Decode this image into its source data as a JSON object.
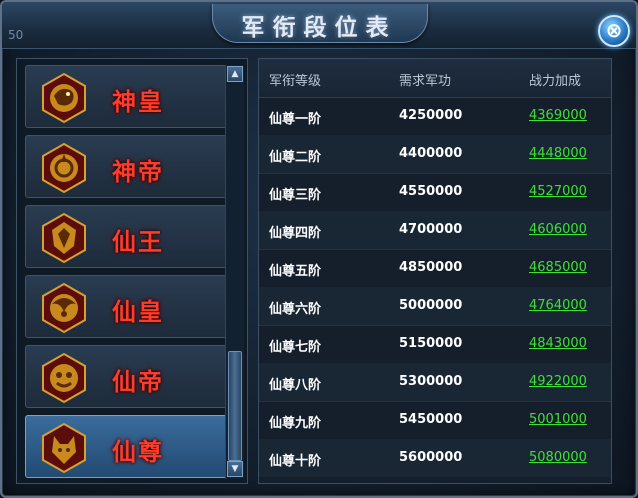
{
  "window": {
    "title": "军衔段位表",
    "corner_number": "50"
  },
  "ranks": [
    {
      "name": "神皇",
      "emblem": "dragon-emblem-icon"
    },
    {
      "name": "神帝",
      "emblem": "flame-emblem-icon"
    },
    {
      "name": "仙王",
      "emblem": "armor-emblem-icon"
    },
    {
      "name": "仙皇",
      "emblem": "phoenix-emblem-icon"
    },
    {
      "name": "仙帝",
      "emblem": "beast-emblem-icon"
    },
    {
      "name": "仙尊",
      "emblem": "wolf-emblem-icon"
    }
  ],
  "selected_rank": "仙尊",
  "table": {
    "headers": [
      "军衔等级",
      "需求军功",
      "战力加成"
    ],
    "rows": [
      {
        "name": "仙尊一阶",
        "requirement": "4250000",
        "bonus": "4369000"
      },
      {
        "name": "仙尊二阶",
        "requirement": "4400000",
        "bonus": "4448000"
      },
      {
        "name": "仙尊三阶",
        "requirement": "4550000",
        "bonus": "4527000"
      },
      {
        "name": "仙尊四阶",
        "requirement": "4700000",
        "bonus": "4606000"
      },
      {
        "name": "仙尊五阶",
        "requirement": "4850000",
        "bonus": "4685000"
      },
      {
        "name": "仙尊六阶",
        "requirement": "5000000",
        "bonus": "4764000"
      },
      {
        "name": "仙尊七阶",
        "requirement": "5150000",
        "bonus": "4843000"
      },
      {
        "name": "仙尊八阶",
        "requirement": "5300000",
        "bonus": "4922000"
      },
      {
        "name": "仙尊九阶",
        "requirement": "5450000",
        "bonus": "5001000"
      },
      {
        "name": "仙尊十阶",
        "requirement": "5600000",
        "bonus": "5080000"
      }
    ]
  },
  "colors": {
    "rank_name": "#ff3b2a",
    "bonus_link": "#3ee034",
    "selected_item": "#3a6c9c"
  }
}
